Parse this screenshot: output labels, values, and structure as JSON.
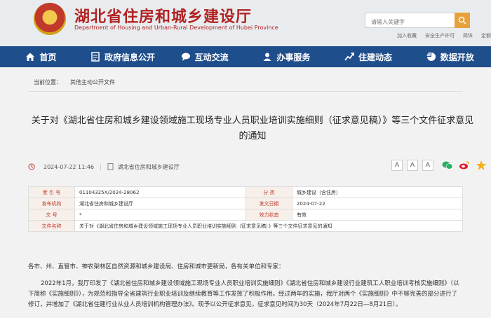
{
  "header": {
    "title": "湖北省住房和城乡建设厅",
    "subtitle": "Department of Housing and Urban-Rural Development of Hubei Province",
    "search_placeholder": "请输入关键字",
    "top_links": [
      "加入收藏",
      "安全生产许可",
      "简体",
      "定额"
    ]
  },
  "nav": [
    {
      "label": "首页",
      "icon": "home-icon"
    },
    {
      "label": "政府信息公开",
      "icon": "document-icon"
    },
    {
      "label": "互动交流",
      "icon": "chat-icon"
    },
    {
      "label": "办事服务",
      "icon": "user-icon"
    },
    {
      "label": "住建动态",
      "icon": "trend-icon"
    },
    {
      "label": "数据开放",
      "icon": "pie-chart-icon"
    }
  ],
  "breadcrumb": {
    "label": "当前位置：",
    "path": "其他主动公开文件"
  },
  "article": {
    "title": "关于对《湖北省住房和城乡建设领域施工现场专业人员职业培训实施细则（征求意见稿）》等三个文件征求意见的通知",
    "date": "2024-07-22 11:46",
    "source": "湖北省住房和城乡建设厅",
    "font_sizes": [
      "A",
      "A",
      "A"
    ]
  },
  "info_table": {
    "index_label": "索 引 号",
    "index_value": "01104325X/2024-28062",
    "category_label": "分 类",
    "category_value": "城乡建设（含住房）",
    "issuer_label": "发布机构",
    "issuer_value": "湖北省住房和城乡建设厅",
    "pubdate_label": "发文日期",
    "pubdate_value": "2024-07-22",
    "docno_label": "文 号",
    "docno_value": "*",
    "validity_label": "效力状态",
    "validity_value": "有效",
    "filename_label": "文件名称",
    "filename_value": "关于对《湖北省住房和城乡建设领域施工现场专业人员职业培训实施细则（征求意见稿）》等三个文件征求意见的通知"
  },
  "body": {
    "greeting": "各市、州、直管市、神农架林区自然资源和城乡建设局、住房和城市更新局，各有关单位和专家：",
    "paragraph": "2022年1月，我厅印发了《湖北省住房和城乡建设领域施工现场专业人员职业培训实施细则》《湖北省住房和城乡建设行业建筑工人职业培训考核实施细则》（以下简称《实施细则》），为规范和指导全省建筑行业职业培训及继续教育等工作发挥了积极作用。经过两年的实施，我厅对两个《实施细则》中不够完善的部分进行了修订，并增加了《湖北省住建行业从业人员培训机构管理办法》。现予以公开征求意见，征求意见时间为30天（2024年7月22日—8月21日）。"
  },
  "colors": {
    "brand_red": "#b22222",
    "nav_blue": "#1f4e8c",
    "search_orange": "#e8a13a"
  }
}
